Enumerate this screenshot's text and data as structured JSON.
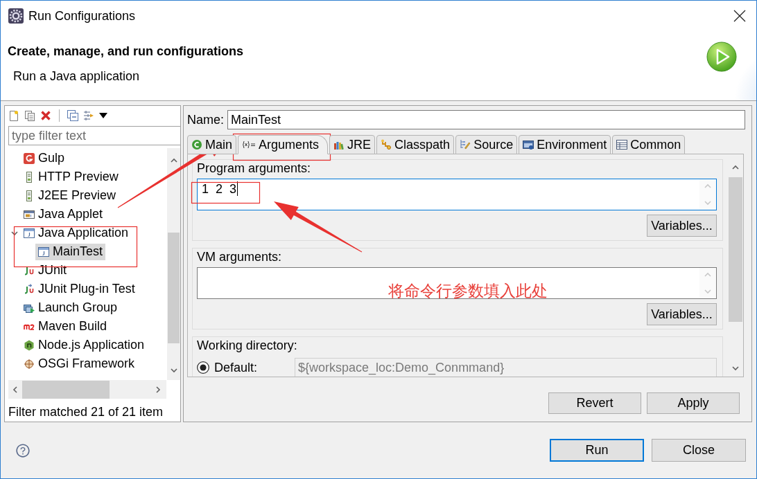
{
  "window": {
    "title": "Run Configurations"
  },
  "header": {
    "title": "Create, manage, and run configurations",
    "subtitle": "Run a Java application"
  },
  "filter": {
    "placeholder": "type filter text"
  },
  "tree": [
    {
      "label": "Gulp",
      "selected": false
    },
    {
      "label": "HTTP Preview",
      "selected": false
    },
    {
      "label": "J2EE Preview",
      "selected": false
    },
    {
      "label": "Java Applet",
      "selected": false
    },
    {
      "label": "Java Application",
      "selected": false,
      "expanded": true,
      "children": [
        {
          "label": "MainTest",
          "selected": true
        }
      ]
    },
    {
      "label": "JUnit",
      "selected": false
    },
    {
      "label": "JUnit Plug-in Test",
      "selected": false
    },
    {
      "label": "Launch Group",
      "selected": false
    },
    {
      "label": "Maven Build",
      "selected": false
    },
    {
      "label": "Node.js Application",
      "selected": false
    },
    {
      "label": "OSGi Framework",
      "selected": false
    }
  ],
  "filter_status": "Filter matched 21 of 21 item",
  "name": {
    "label": "Name:",
    "value": "MainTest"
  },
  "tabs": [
    {
      "label": "Main",
      "selected": false
    },
    {
      "label": "Arguments",
      "selected": true
    },
    {
      "label": "JRE",
      "selected": false
    },
    {
      "label": "Classpath",
      "selected": false
    },
    {
      "label": "Source",
      "selected": false
    },
    {
      "label": "Environment",
      "selected": false
    },
    {
      "label": "Common",
      "selected": false
    }
  ],
  "program_arguments": {
    "label": "Program arguments:",
    "value": "1  2  3",
    "focused": true,
    "button": "Variables..."
  },
  "vm_arguments": {
    "label": "VM arguments:",
    "focused": false,
    "button": "Variables..."
  },
  "working_directory": {
    "label": "Working directory:",
    "option": {
      "label": "Default:",
      "selected": true
    },
    "value": "${workspace_loc:Demo_Conmmand}",
    "disabled": true
  },
  "config_buttons": [
    {
      "label": "Revert"
    },
    {
      "label": "Apply"
    }
  ],
  "dialog_buttons": [
    {
      "label": "Run",
      "default": true
    },
    {
      "label": "Close",
      "default": false
    }
  ],
  "annotation": {
    "text": "将命令行参数填入此处"
  }
}
